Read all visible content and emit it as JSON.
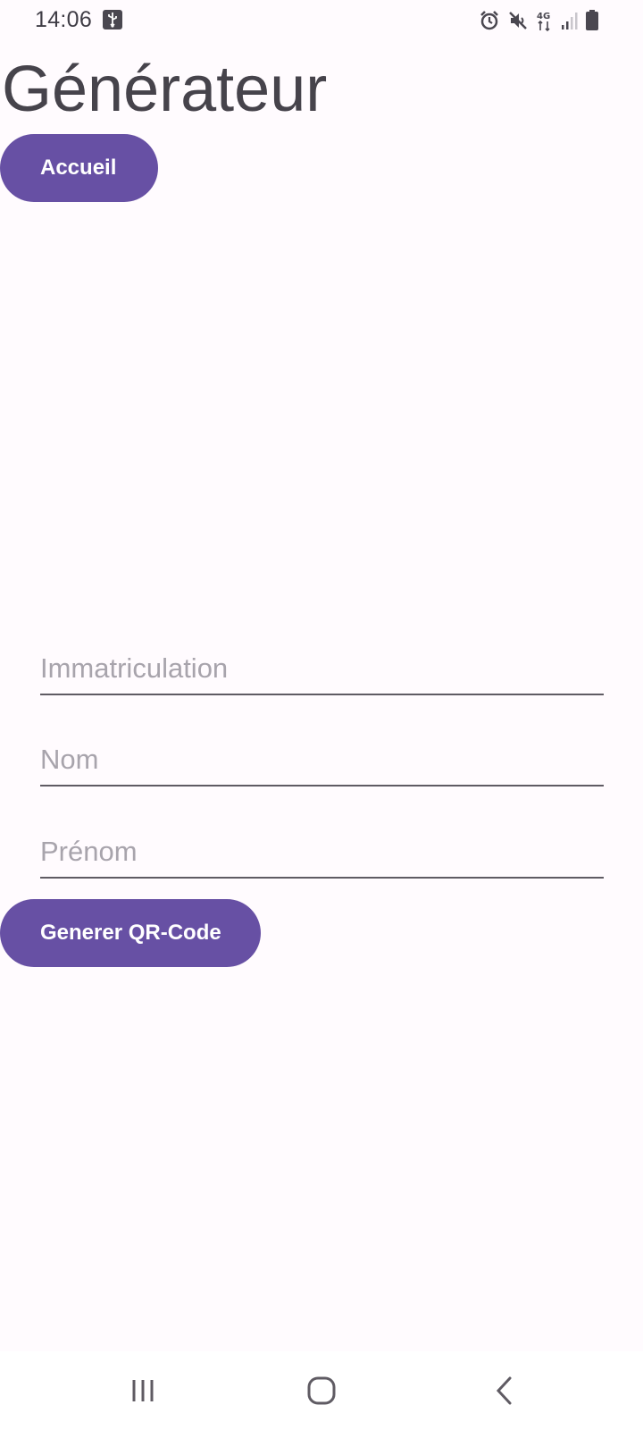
{
  "status_bar": {
    "time": "14:06",
    "icons": [
      "usb-icon",
      "alarm-icon",
      "mute-icon",
      "network-4g-icon",
      "signal-icon",
      "battery-icon"
    ],
    "network_label": "4G"
  },
  "title": "Générateur",
  "home_button": {
    "label": "Accueil"
  },
  "form": {
    "immatriculation_placeholder": "Immatriculation",
    "nom_placeholder": "Nom",
    "prenom_placeholder": "Prénom"
  },
  "qr_button": {
    "label": "Generer QR-Code"
  },
  "nav_bar": {
    "icons": [
      "recents-icon",
      "home-icon",
      "back-icon"
    ]
  },
  "colors": {
    "accent": "#6750a4",
    "background": "#fffbfe",
    "text": "#49454f",
    "placeholder": "#a8a4ac"
  }
}
